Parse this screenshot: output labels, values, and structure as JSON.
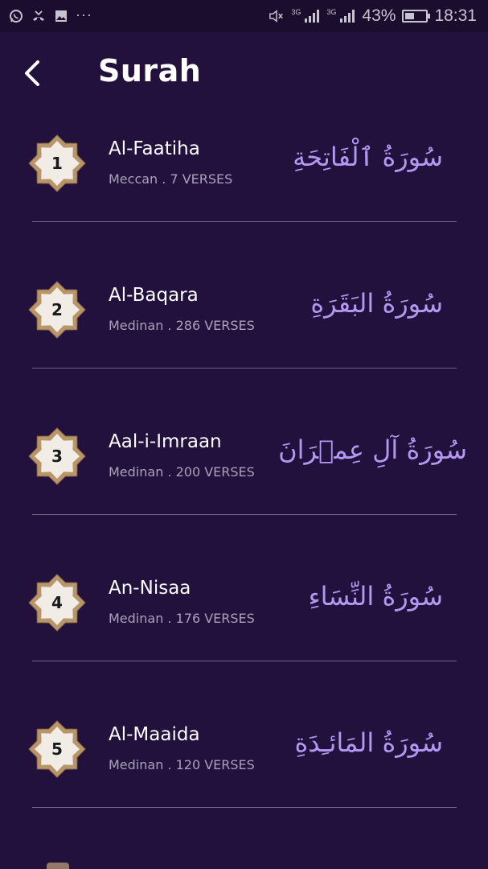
{
  "status_bar": {
    "network_1": "3G",
    "network_2": "3G",
    "battery": "43%",
    "battery_level": 0.43,
    "time": "18:31",
    "left_icons": [
      "whatsapp-icon",
      "missed-call-icon",
      "image-icon",
      "more-dots-icon"
    ],
    "right_icons": [
      "mute-icon",
      "signal-icon",
      "signal-icon",
      "battery-icon"
    ]
  },
  "header": {
    "title": "Surah",
    "back_icon": "chevron-left-icon"
  },
  "colors": {
    "background": "#22113d",
    "accent_arabic": "#b497f0",
    "badge_gold": "#c2a57a"
  },
  "surahs": [
    {
      "number": "1",
      "name": "Al-Faatiha",
      "meta": "Meccan . 7 VERSES",
      "arabic": "سُورَةُ ٱلْفَاتِحَةِ"
    },
    {
      "number": "2",
      "name": "Al-Baqara",
      "meta": "Medinan . 286 VERSES",
      "arabic": "سُورَةُ البَقَرَةِ"
    },
    {
      "number": "3",
      "name": "Aal-i-Imraan",
      "meta": "Medinan . 200 VERSES",
      "arabic": "سُورَةُ آلِ عِمۡرَانَ"
    },
    {
      "number": "4",
      "name": "An-Nisaa",
      "meta": "Medinan . 176 VERSES",
      "arabic": "سُورَةُ النِّسَاءِ"
    },
    {
      "number": "5",
      "name": "Al-Maaida",
      "meta": "Medinan . 120 VERSES",
      "arabic": "سُورَةُ المَائـِدَةِ"
    }
  ]
}
